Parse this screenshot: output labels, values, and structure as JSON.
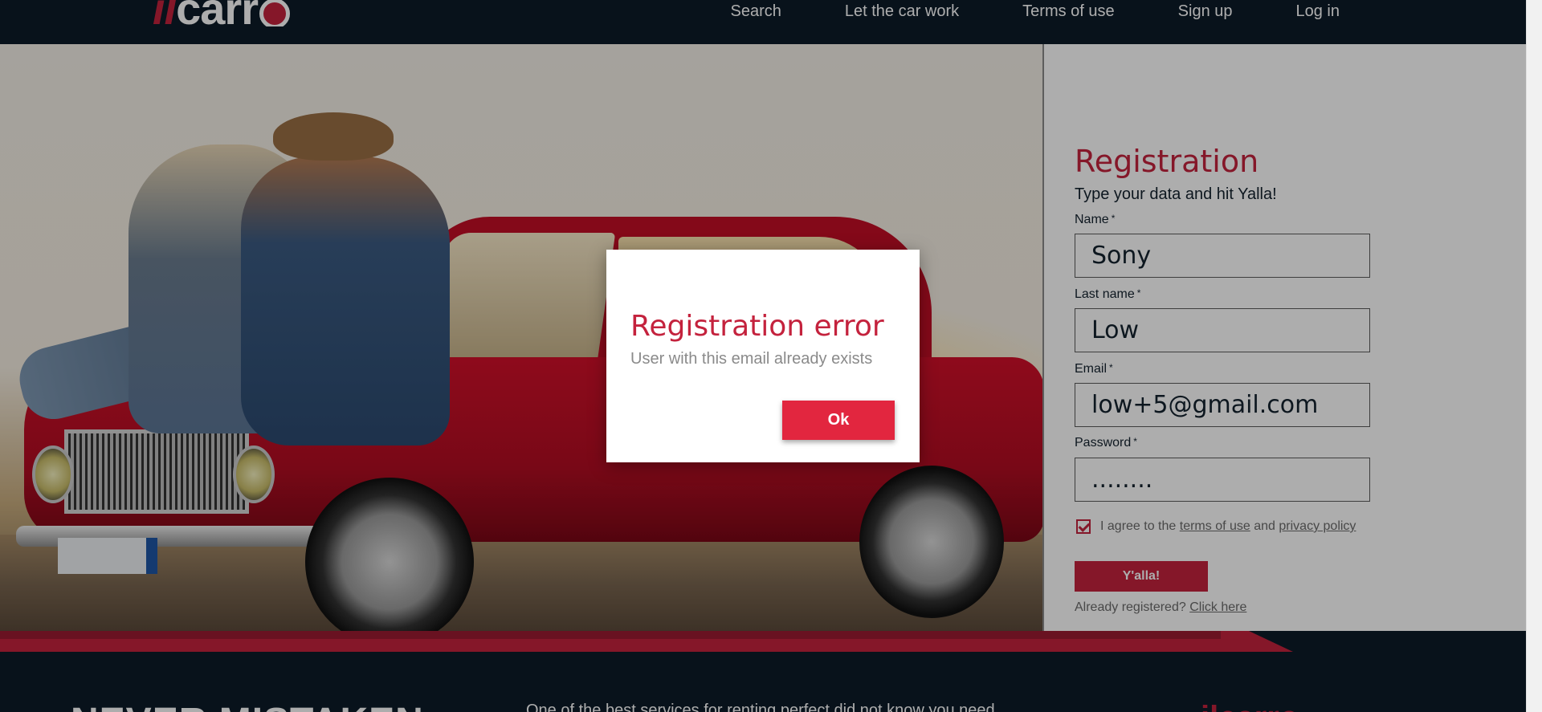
{
  "brand": {
    "logo_prefix": "il",
    "logo_main": "carr",
    "primary_color": "#c4223d",
    "dark_color": "#0c1b29"
  },
  "nav": {
    "items": [
      {
        "label": "Search"
      },
      {
        "label": "Let the car work"
      },
      {
        "label": "Terms of use"
      },
      {
        "label": "Sign up"
      },
      {
        "label": "Log in"
      }
    ]
  },
  "registration": {
    "title": "Registration",
    "subtitle": "Type your data and hit Yalla!",
    "required_mark": "*",
    "fields": {
      "name": {
        "label": "Name",
        "value": "Sony"
      },
      "last_name": {
        "label": "Last name",
        "value": "Low"
      },
      "email": {
        "label": "Email",
        "value": "low+5@gmail.com"
      },
      "password": {
        "label": "Password",
        "value": "........"
      }
    },
    "agree": {
      "checked": true,
      "prefix": "I agree to the",
      "terms_link": "terms of use",
      "conjunction": "and",
      "privacy_link": "privacy policy"
    },
    "submit_label": "Y'alla!",
    "already_text": "Already registered?",
    "click_here": "Click here"
  },
  "modal": {
    "title": "Registration error",
    "message": "User with this email already exists",
    "ok_label": "Ok"
  },
  "footer": {
    "heading": "NEVER MISTAKEN",
    "text": "One of the best services for renting perfect did not know you need",
    "red_text": "ilcarro"
  }
}
